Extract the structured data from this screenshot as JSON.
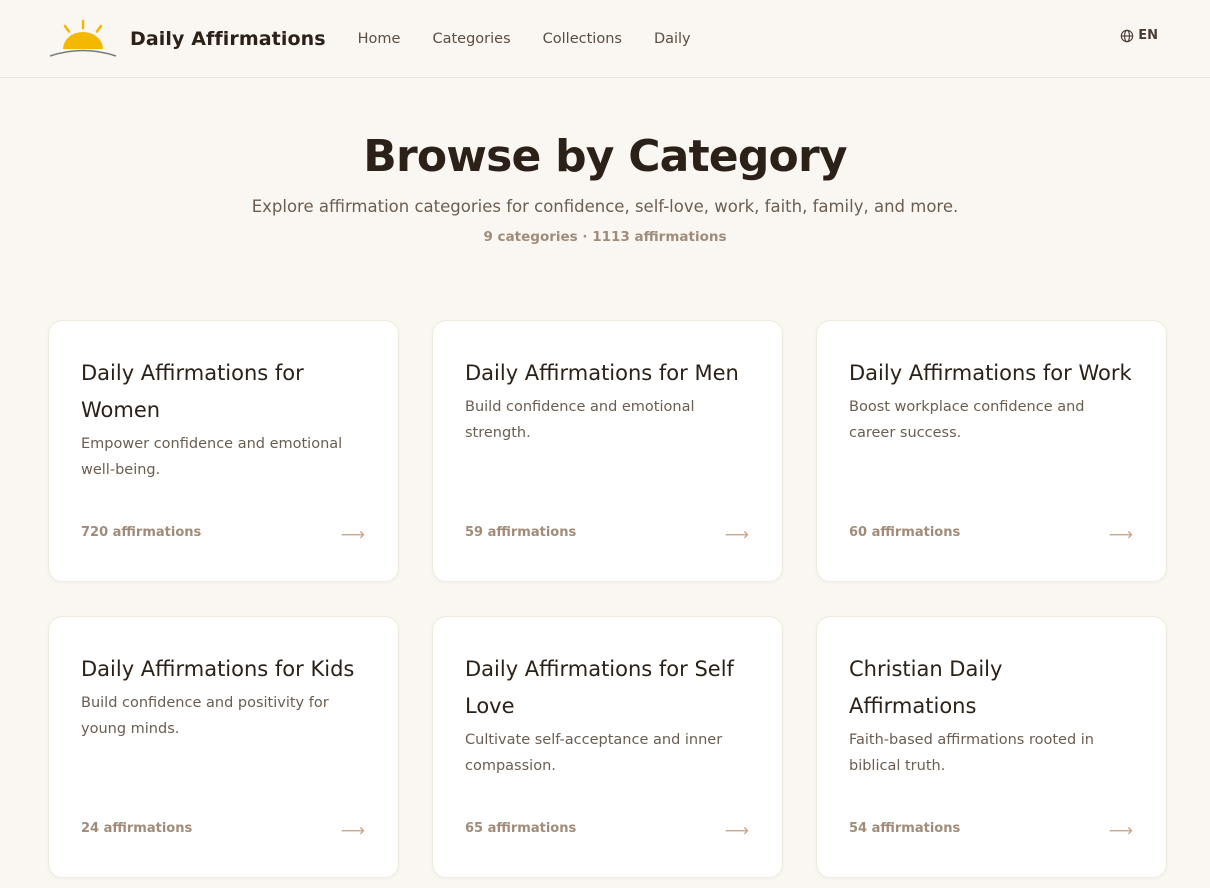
{
  "header": {
    "brand": "Daily Affirmations",
    "nav": [
      "Home",
      "Categories",
      "Collections",
      "Daily"
    ],
    "language": "EN",
    "logo_icon": "sunrise-icon",
    "globe_icon": "globe-icon"
  },
  "hero": {
    "title": "Browse by Category",
    "subtitle": "Explore affirmation categories for confidence, self-love, work, faith, family, and more.",
    "stats": "9 categories · 1113 affirmations"
  },
  "categories": [
    {
      "title": "Daily Affirmations for Women",
      "description": "Empower confidence and emotional well-being.",
      "count": "720 affirmations",
      "arrow": "⟶"
    },
    {
      "title": "Daily Affirmations for Men",
      "description": "Build confidence and emotional strength.",
      "count": "59 affirmations",
      "arrow": "⟶"
    },
    {
      "title": "Daily Affirmations for Work",
      "description": "Boost workplace confidence and career success.",
      "count": "60 affirmations",
      "arrow": "⟶"
    },
    {
      "title": "Daily Affirmations for Kids",
      "description": "Build confidence and positivity for young minds.",
      "count": "24 affirmations",
      "arrow": "⟶"
    },
    {
      "title": "Daily Affirmations for Self Love",
      "description": "Cultivate self-acceptance and inner compassion.",
      "count": "65 affirmations",
      "arrow": "⟶"
    },
    {
      "title": "Christian Daily Affirmations",
      "description": "Faith-based affirmations rooted in biblical truth.",
      "count": "54 affirmations",
      "arrow": "⟶"
    }
  ],
  "colors": {
    "background": "#faf7f2",
    "sun": "#f5b800",
    "accent_muted": "#a08c7a",
    "arrow": "#c9a788"
  }
}
